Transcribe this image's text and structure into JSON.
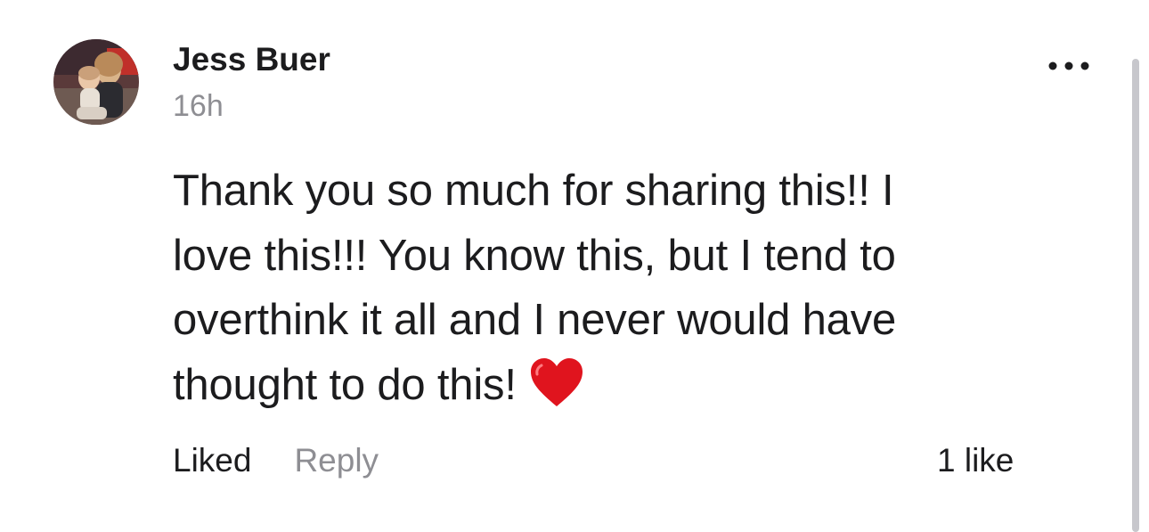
{
  "comment": {
    "author": "Jess Buer",
    "timestamp": "16h",
    "body": "Thank you so much for sharing this!!  I\nlove this!!! You know this, but I tend to\noverthink it all and I never would have\nthought to do this!",
    "emoji": "heart-icon"
  },
  "actions": {
    "liked_label": "Liked",
    "reply_label": "Reply",
    "like_count": "1 like"
  },
  "icons": {
    "more": "more-options-icon",
    "heart": "heart-icon"
  },
  "colors": {
    "text_primary": "#1c1c1e",
    "text_secondary": "#8e8e93",
    "heart": "#e0141e"
  }
}
